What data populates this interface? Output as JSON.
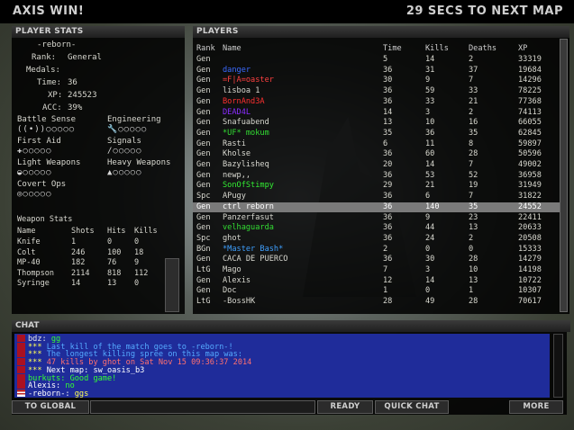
{
  "top": {
    "left_text": "AXIS WIN!",
    "right_text": "29 SECS TO NEXT MAP"
  },
  "stats": {
    "title": "PLAYER STATS",
    "name": "-reborn-",
    "rank_label": "Rank:",
    "rank": "General",
    "medals_label": "Medals:",
    "time_label": "Time:",
    "time": "36",
    "xp_label": "XP:",
    "xp": "245523",
    "acc_label": "ACC:",
    "acc": "39%",
    "skills": {
      "battle_sense": "Battle Sense",
      "engineering": "Engineering",
      "first_aid": "First Aid",
      "signals": "Signals",
      "light_weapons": "Light Weapons",
      "heavy_weapons": "Heavy Weapons",
      "covert_ops": "Covert Ops"
    },
    "weapon_stats": {
      "title": "Weapon Stats",
      "headers": [
        "Name",
        "Shots",
        "Hits",
        "Kills"
      ],
      "rows": [
        [
          "Knife",
          "1",
          "0",
          "0"
        ],
        [
          "Colt",
          "246",
          "100",
          "18"
        ],
        [
          "MP-40",
          "182",
          "76",
          "9"
        ],
        [
          "Thompson",
          "2114",
          "818",
          "112"
        ],
        [
          "Syringe",
          "14",
          "13",
          "0"
        ]
      ]
    }
  },
  "players": {
    "title": "PLAYERS",
    "headers": [
      "Rank",
      "Name",
      "Time",
      "Kills",
      "Deaths",
      "XP"
    ],
    "rows": [
      [
        "Gen",
        "",
        "5",
        "14",
        "2",
        "33319"
      ],
      [
        "Gen",
        "danger",
        "36",
        "31",
        "37",
        "19684"
      ],
      [
        "Gen",
        "=F|A=oaster",
        "30",
        "9",
        "7",
        "14296"
      ],
      [
        "Gen",
        "lisboa 1",
        "36",
        "59",
        "33",
        "78225"
      ],
      [
        "Gen",
        "BornAnd3A",
        "36",
        "33",
        "21",
        "77368"
      ],
      [
        "Gen",
        "DEAD4L",
        "14",
        "3",
        "2",
        "74113"
      ],
      [
        "Gen",
        "Snafuabend",
        "13",
        "10",
        "16",
        "66055"
      ],
      [
        "Gen",
        "*UF* mokum",
        "35",
        "36",
        "35",
        "62845"
      ],
      [
        "Gen",
        "Rasti",
        "6",
        "11",
        "8",
        "59897"
      ],
      [
        "Gen",
        "Kholse",
        "36",
        "60",
        "28",
        "50596"
      ],
      [
        "Gen",
        "Bazylisheq",
        "20",
        "14",
        "7",
        "49002"
      ],
      [
        "Gen",
        "newp,,",
        "36",
        "53",
        "52",
        "36958"
      ],
      [
        "Gen",
        "SonOfStimpy",
        "29",
        "21",
        "19",
        "31949"
      ],
      [
        "Spc",
        "APugy",
        "36",
        "6",
        "7",
        "31822"
      ],
      [
        "Gen",
        "ctrl reborn",
        "36",
        "140",
        "35",
        "24552"
      ],
      [
        "Gen",
        "Panzerfasut",
        "36",
        "9",
        "23",
        "22411"
      ],
      [
        "Gen",
        "velhaguarda",
        "36",
        "44",
        "13",
        "20633"
      ],
      [
        "Spc",
        "ghot",
        "36",
        "24",
        "2",
        "20508"
      ],
      [
        "BGn",
        "*Master Bash*",
        "2",
        "0",
        "0",
        "15333"
      ],
      [
        "Gen",
        "CACA DE PUERCO",
        "36",
        "30",
        "28",
        "14279"
      ],
      [
        "LtG",
        "Mago",
        "7",
        "3",
        "10",
        "14198"
      ],
      [
        "Gen",
        "Alexis",
        "12",
        "14",
        "13",
        "10722"
      ],
      [
        "Gen",
        "Doc",
        "1",
        "0",
        "1",
        "10307"
      ],
      [
        "LtG",
        "-BossHK",
        "28",
        "49",
        "28",
        "70617"
      ]
    ],
    "row_colors": [
      "#d8d8d0",
      "#3b6bff",
      "#ff4040",
      "#d8d8d0",
      "#ff3030",
      "#8a2cff",
      "#d8d8d0",
      "#33dd33",
      "#d8d8d0",
      "#d8d8d0",
      "#d8d8d0",
      "#d8d8d0",
      "#33ee33",
      "#d8d8d0",
      "#ffffff",
      "#d8d8d0",
      "#33dd33",
      "#d8d8d0",
      "#3fa0ff",
      "#d8d8d0",
      "#d8d8d0",
      "#d8d8d0",
      "#d8d8d0",
      "#d8d8d0"
    ]
  },
  "chat": {
    "title": "CHAT",
    "lines": [
      {
        "prefix": "bdz: ",
        "text": "gg",
        "color": "#e8e8e8",
        "tcolor": "#33ff33"
      },
      {
        "prefix": "*** ",
        "text": "Last kill of the match goes to -reborn-!",
        "color": "#ffff55",
        "tcolor": "#55aaff"
      },
      {
        "prefix": "*** ",
        "text": "The longest killing spree on this map was:",
        "color": "#ffff55",
        "tcolor": "#55aaff"
      },
      {
        "prefix": "*** ",
        "text": "47 kills by ghot on Sat Nov 15 09:36:37 2014",
        "color": "#ffff55",
        "tcolor": "#ff7070"
      },
      {
        "prefix": "*** ",
        "text": "Next map: sw_oasis_b3",
        "color": "#ffff55",
        "tcolor": "#ffffff"
      },
      {
        "prefix": "burkuts: ",
        "text": "Good game!",
        "color": "#33ff33",
        "tcolor": "#33ff33"
      },
      {
        "prefix": "Alexis: ",
        "text": "no",
        "color": "#ffffff",
        "tcolor": "#33ff33"
      },
      {
        "prefix": "-reborn-: ",
        "text": "ggs",
        "color": "#ffffff",
        "tcolor": "#ffff55"
      }
    ]
  },
  "buttons": {
    "to_global": "TO GLOBAL",
    "ready": "READY",
    "quick_chat": "QUICK CHAT",
    "more": "MORE"
  }
}
